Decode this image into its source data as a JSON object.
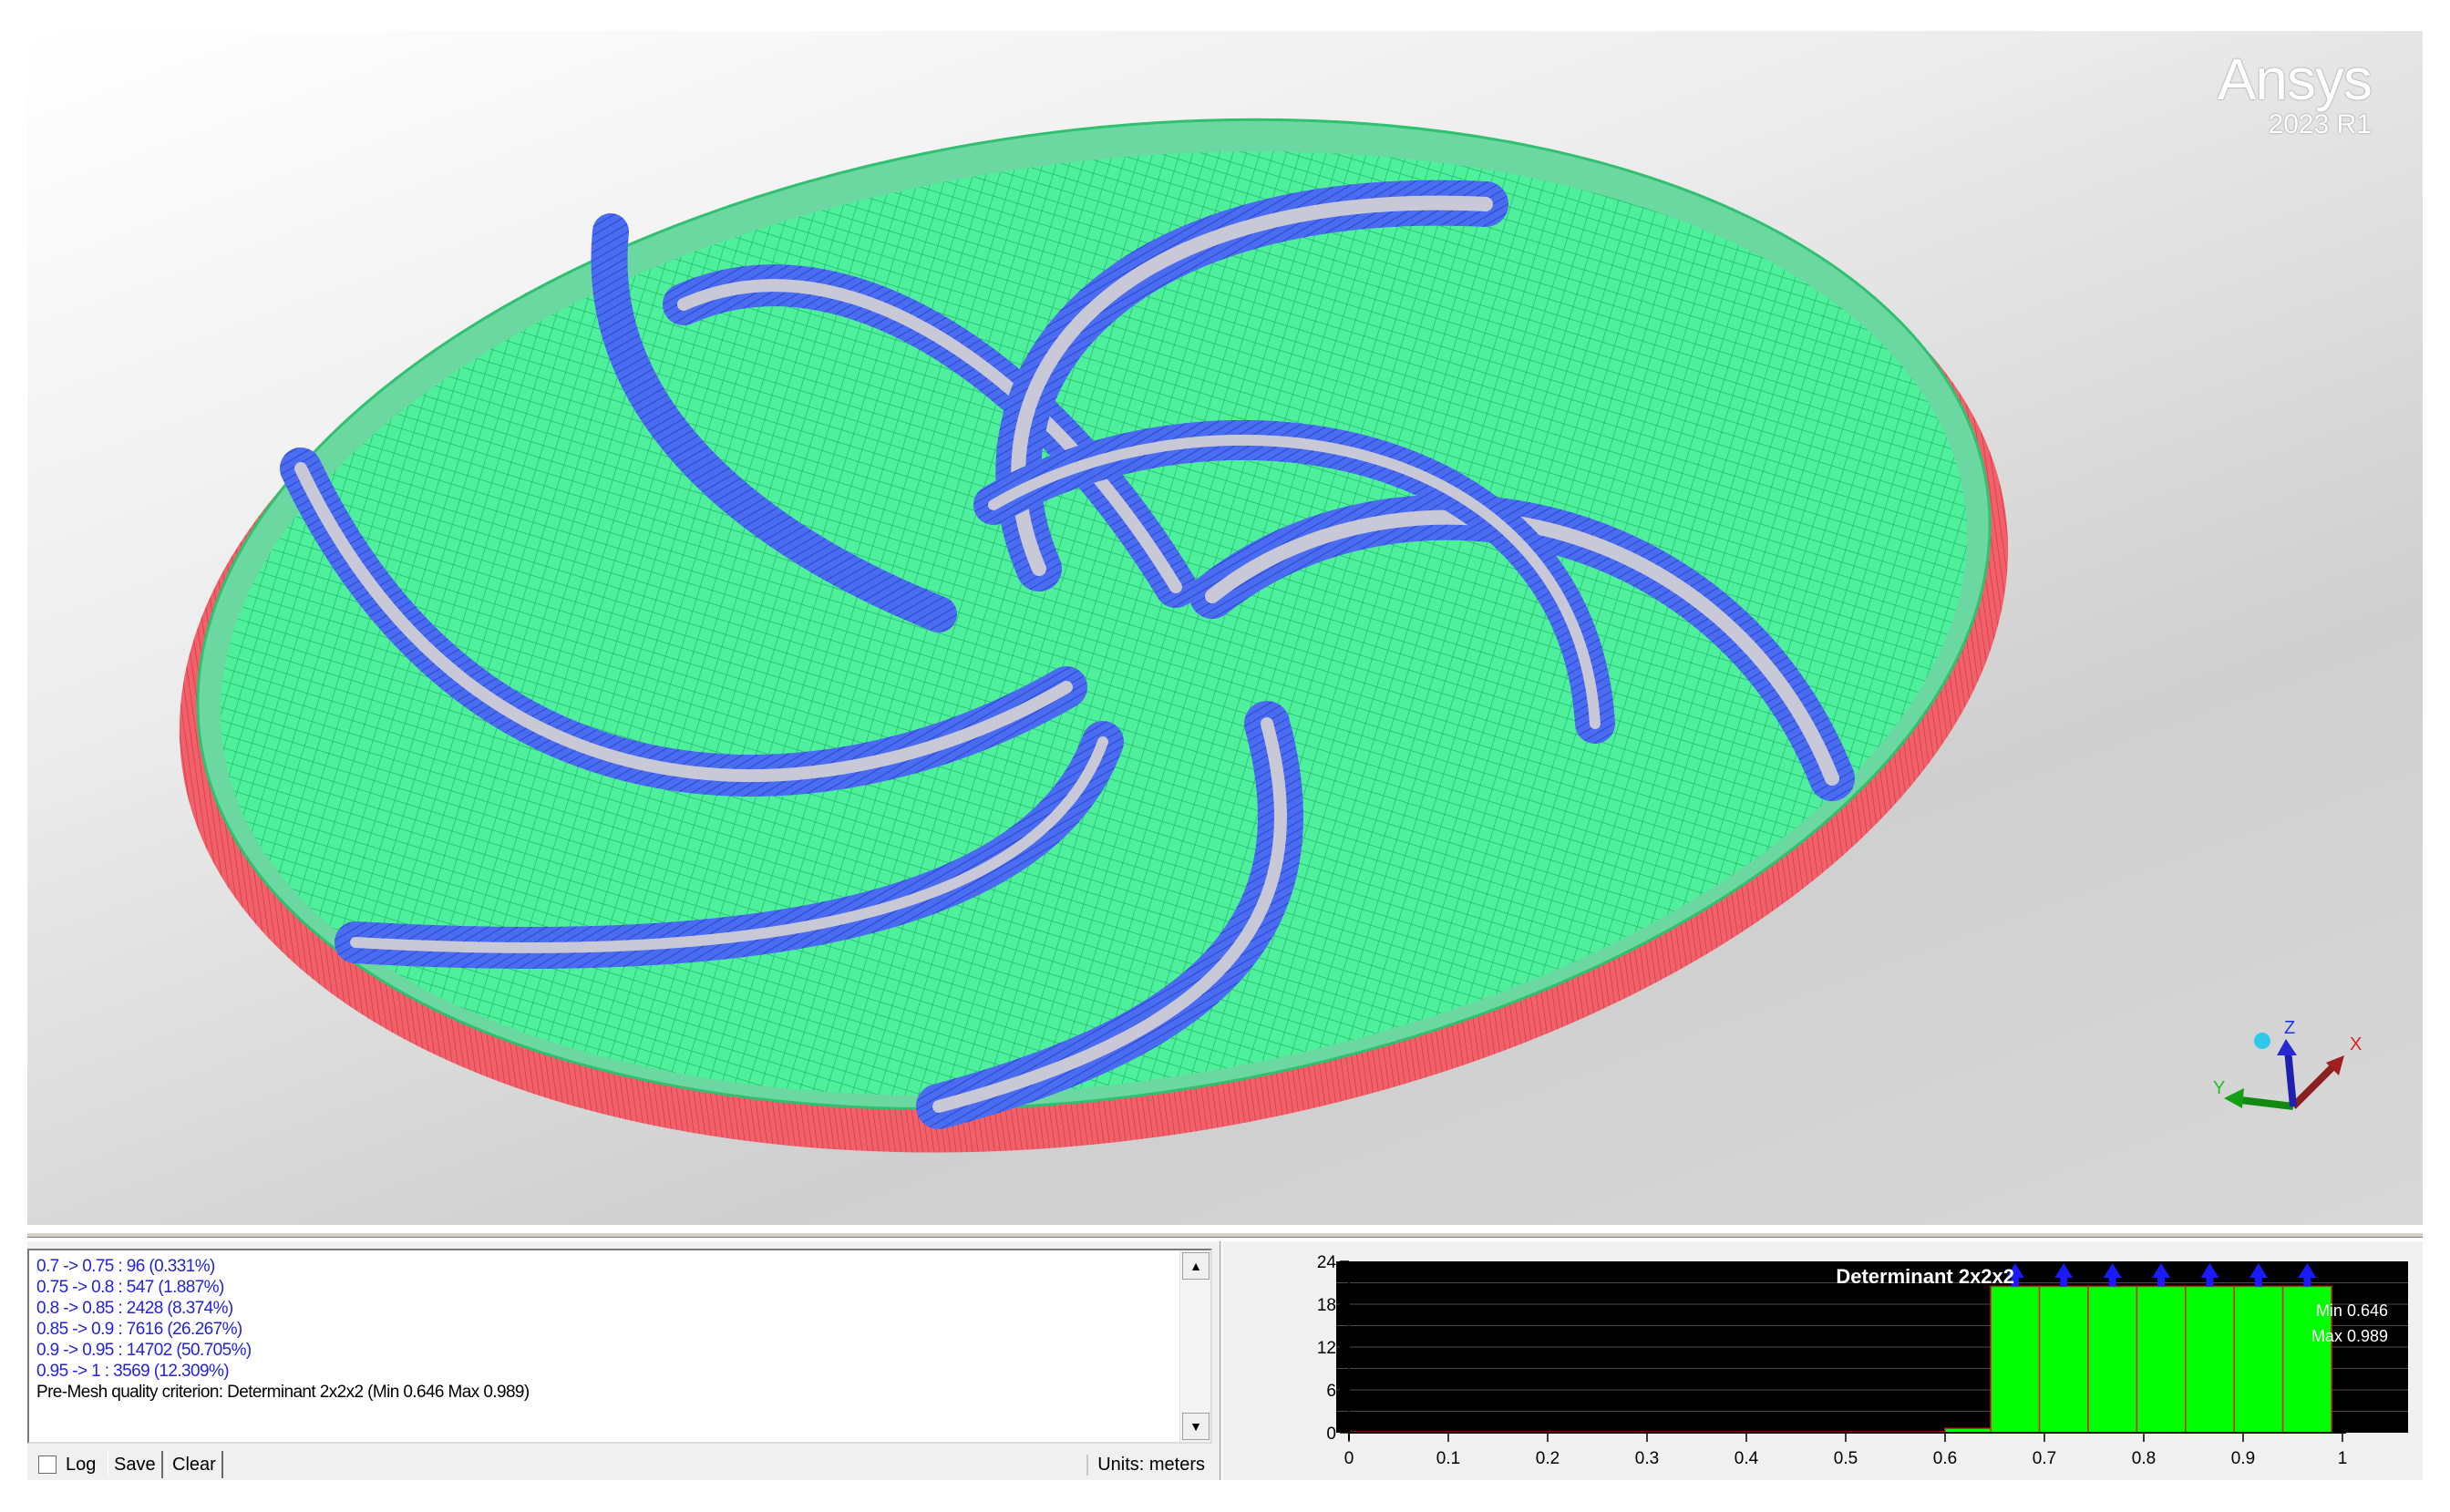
{
  "viewport": {
    "brand_name": "Ansys",
    "brand_version": "2023 R1",
    "colors": {
      "blade": "#3a5ae8",
      "mesh": "#3ee88e",
      "rim": "#f0505a",
      "gap": "#c8c8d6"
    },
    "triad": {
      "x_label": "X",
      "y_label": "Y",
      "z_label": "Z"
    }
  },
  "log": {
    "lines": [
      "0.7 -> 0.75 : 96 (0.331%)",
      "0.75 -> 0.8 : 547 (1.887%)",
      "0.8 -> 0.85 : 2428 (8.374%)",
      "0.85 -> 0.9 : 7616 (26.267%)",
      "0.9 -> 0.95 : 14702 (50.705%)",
      "0.95 -> 1 : 3569 (12.309%)",
      "Pre-Mesh quality criterion: Determinant 2x2x2 (Min 0.646 Max 0.989)"
    ],
    "scroll_up_icon": "arrow-up",
    "scroll_down_icon": "arrow-down"
  },
  "toolbar": {
    "log_label": "Log",
    "log_checked": false,
    "save_label": "Save",
    "clear_label": "Clear",
    "units_label": "Units: meters"
  },
  "chart_data": {
    "type": "bar",
    "title": "Determinant 2x2x2",
    "xlabel": "",
    "ylabel": "",
    "xlim": [
      0,
      1
    ],
    "ylim": [
      0,
      24
    ],
    "xticks": [
      "0",
      "0.1",
      "0.2",
      "0.3",
      "0.4",
      "0.5",
      "0.6",
      "0.7",
      "0.8",
      "0.9",
      "1"
    ],
    "yticks": [
      "0",
      "6",
      "12",
      "18",
      "24"
    ],
    "min_label": "Min 0.646",
    "max_label": "Max 0.989",
    "bar_color": "#00ff00",
    "bars": [
      {
        "x0": 0.0,
        "x1": 0.6,
        "value": 0.1
      },
      {
        "x0": 0.6,
        "x1": 0.646,
        "value": 0.6
      },
      {
        "x0": 0.646,
        "x1": 0.695,
        "value": 20.5
      },
      {
        "x0": 0.695,
        "x1": 0.744,
        "value": 20.5
      },
      {
        "x0": 0.744,
        "x1": 0.793,
        "value": 20.5
      },
      {
        "x0": 0.793,
        "x1": 0.842,
        "value": 20.5
      },
      {
        "x0": 0.842,
        "x1": 0.891,
        "value": 20.5
      },
      {
        "x0": 0.891,
        "x1": 0.94,
        "value": 20.5
      },
      {
        "x0": 0.94,
        "x1": 0.989,
        "value": 20.5
      }
    ]
  }
}
